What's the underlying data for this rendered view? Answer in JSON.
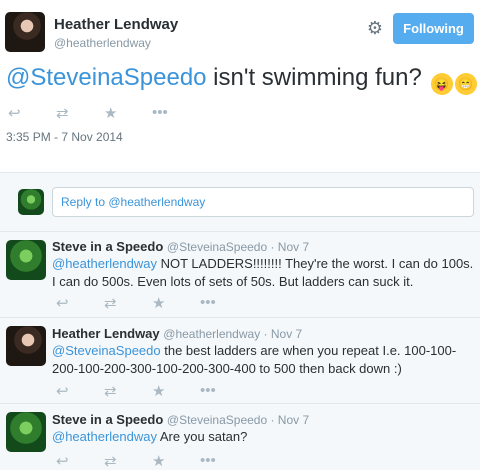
{
  "tweet": {
    "name": "Heather Lendway",
    "handle": "@heatherlendway",
    "follow_label": "Following",
    "mention": "@SteveinaSpeedo",
    "text": " isn't swimming fun?",
    "emoji1": "😝",
    "emoji2": "😁",
    "timestamp": "3:35 PM - 7 Nov 2014",
    "actions": {
      "reply": "reply-icon",
      "retweet": "retweet-icon",
      "favorite": "favorite-icon",
      "more": "more-icon"
    }
  },
  "reply_box": {
    "text": "Reply to @heatherlendway"
  },
  "replies": [
    {
      "name": "Steve in a Speedo",
      "handle": "@SteveinaSpeedo · Nov 7",
      "mention": "@heatherlendway",
      "text": " NOT LADDERS!!!!!!!!  They're the worst.  I can do 100s.  I can do 500s.  Even lots of sets of 50s.  But ladders can suck it."
    },
    {
      "name": "Heather Lendway",
      "handle": "@heatherlendway · Nov 7",
      "mention": "@SteveinaSpeedo",
      "text": " the best ladders are when you repeat I.e. 100-100-200-100-200-300-100-200-300-400 to 500 then back down :)"
    },
    {
      "name": "Steve in a Speedo",
      "handle": "@SteveinaSpeedo · Nov 7",
      "mention": "@heatherlendway",
      "text": " Are you satan?"
    }
  ]
}
